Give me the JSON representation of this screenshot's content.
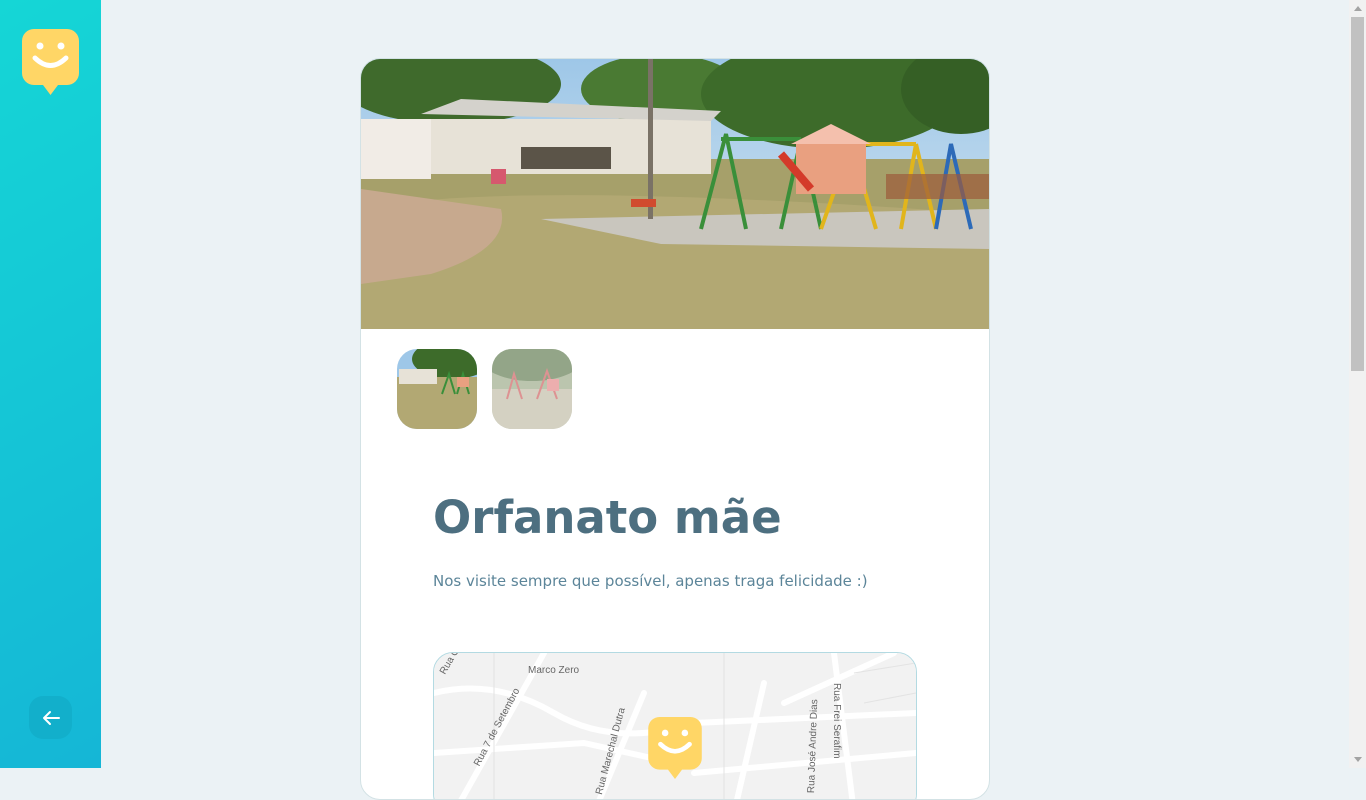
{
  "sidebar": {
    "logo_icon": "happy-map-marker-icon",
    "back_icon": "arrow-left-icon"
  },
  "orphanage": {
    "name": "Orfanato mãe",
    "about": "Nos visite sempre que possível, apenas traga felicidade :)",
    "images": [
      {
        "alt": "playground-photo-1",
        "active": true
      },
      {
        "alt": "playground-photo-2",
        "active": false
      }
    ]
  },
  "map": {
    "labels": [
      "Marco Zero",
      "Rua 7 de Setembro",
      "Rua Marechal Dutra",
      "Rua José Andre Dias",
      "Rua Frei Serafim",
      "Rua O"
    ],
    "marker_icon": "happy-map-marker-icon"
  },
  "colors": {
    "accent": "#15c3d6",
    "marker": "#ffd666",
    "title": "#4d6f80",
    "text": "#5c8599",
    "background": "#ebf2f5"
  }
}
